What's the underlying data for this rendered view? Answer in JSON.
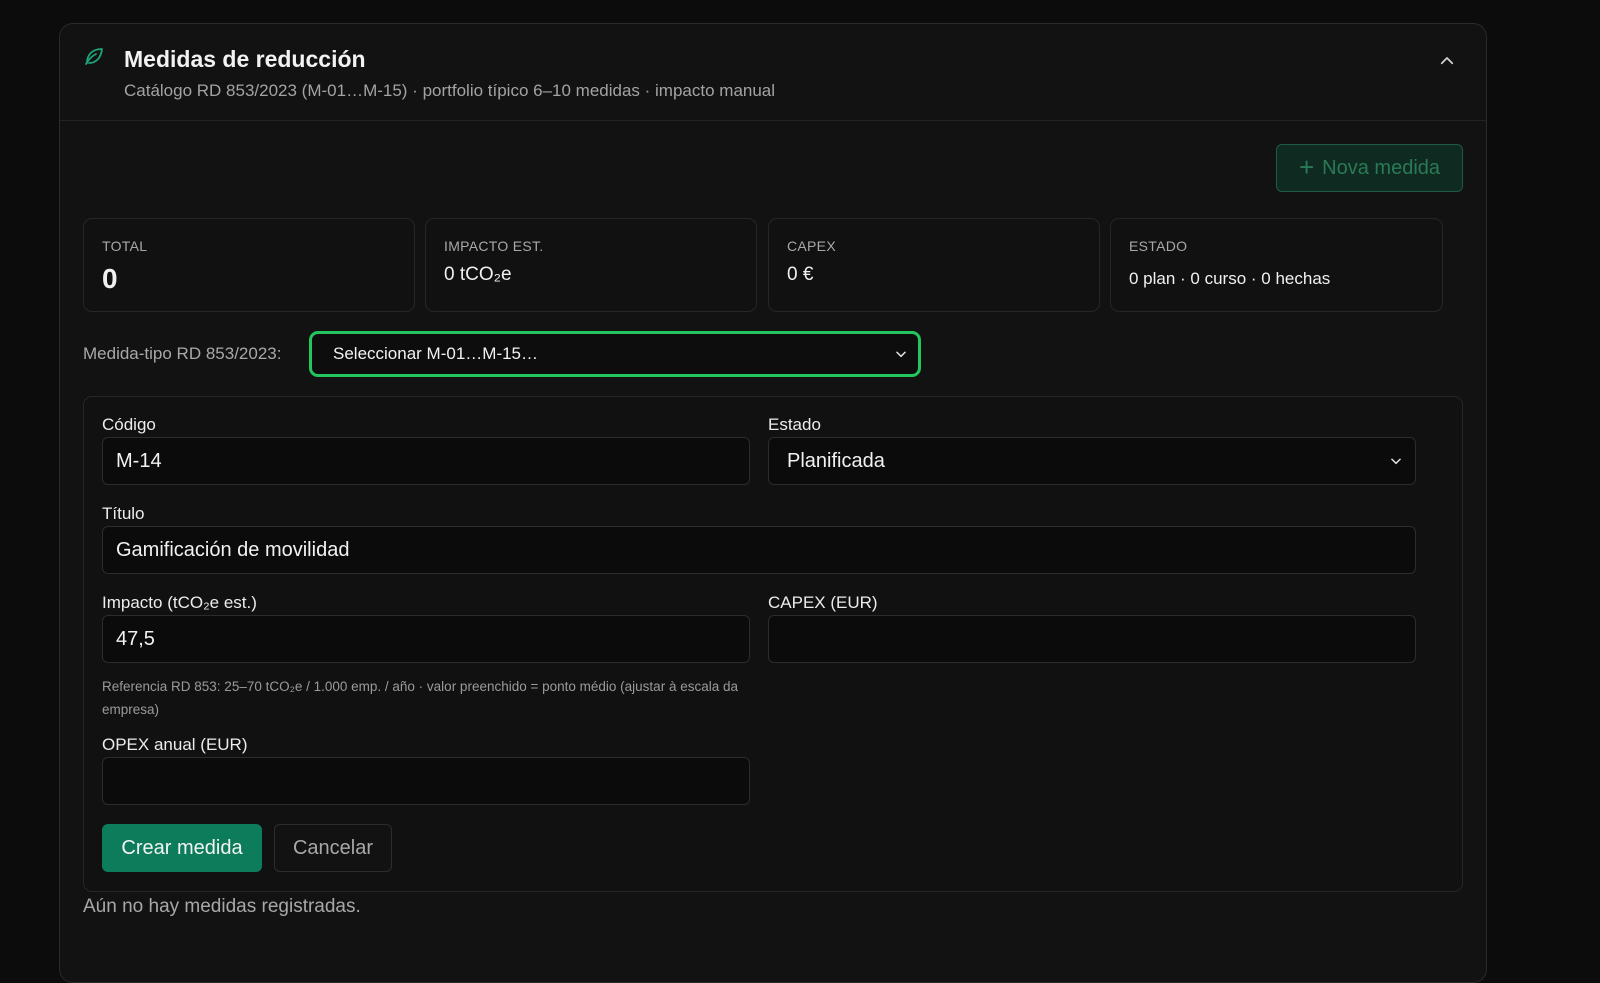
{
  "section": {
    "title": "Medidas de reducción",
    "subtitle": "Catálogo RD 853/2023 (M-01…M-15) · portfolio típico 6–10 medidas · impacto manual",
    "new_button": "Nova medida"
  },
  "stats": [
    {
      "label": "TOTAL",
      "value": "0"
    },
    {
      "label": "IMPACTO EST.",
      "value": "0 tCO₂e"
    },
    {
      "label": "CAPEX",
      "value": "0 €"
    },
    {
      "label": "ESTADO",
      "value": "0 plan · 0 curso · 0 hechas"
    }
  ],
  "type_selector": {
    "label": "Medida-tipo RD 853/2023:",
    "value": "Seleccionar M-01…M-15…"
  },
  "form": {
    "code_label": "Código",
    "code_value": "M-14",
    "status_label": "Estado",
    "status_value": "Planificada",
    "title_label": "Título",
    "title_value": "Gamificación de movilidad",
    "impact_label": "Impacto (tCO₂e est.)",
    "impact_value": "47,5",
    "capex_label": "CAPEX (EUR)",
    "capex_value": "",
    "impact_hint": "Referencia RD 853: 25–70 tCO₂e / 1.000 emp. / año · valor preenchido = ponto médio (ajustar à escala da empresa)",
    "opex_label": "OPEX anual (EUR)",
    "opex_value": "",
    "create_button": "Crear medida",
    "cancel_button": "Cancelar"
  },
  "empty_message": "Aún no hay medidas registradas.",
  "colors": {
    "accent": "#22c55e",
    "primary_button": "#0c7c5a",
    "icon": "#1fa37a"
  },
  "icons": {
    "section": "leaf-icon",
    "collapse": "chevron-up-icon",
    "select": "chevron-down-icon",
    "add": "plus-icon"
  }
}
